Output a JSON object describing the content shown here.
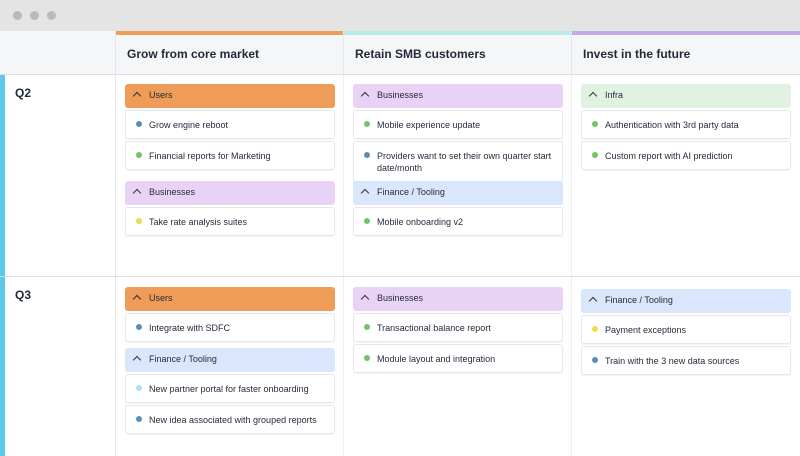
{
  "colors": {
    "blue_dot": "#5b8db5",
    "green_dot": "#72c366",
    "yellow_dot": "#f3d94c",
    "lightblue_dot": "#aee0f5",
    "users_head": "#ee9c57",
    "businesses_head": "#e8d3f6",
    "finance_head": "#dae6fb",
    "infra_head": "#e2f2e2",
    "col1_stripe": "#ee9c57",
    "col2_stripe": "#b9ebe9",
    "col3_stripe": "#c6a9ec",
    "row_stripe": "#5cc8ea"
  },
  "columns": [
    {
      "title": "Grow from core market"
    },
    {
      "title": "Retain SMB customers"
    },
    {
      "title": "Invest in the future"
    }
  ],
  "rows": [
    {
      "title": "Q2"
    },
    {
      "title": "Q3"
    }
  ],
  "cells": {
    "q2_c1": [
      {
        "label": "Users",
        "items": [
          {
            "text": "Grow engine reboot",
            "dot": "blue"
          },
          {
            "text": "Financial reports for Marketing",
            "dot": "green"
          }
        ]
      },
      {
        "label": "Businesses",
        "items": [
          {
            "text": "Take rate analysis suites",
            "dot": "yellow"
          }
        ]
      }
    ],
    "q2_c2": [
      {
        "label": "Businesses",
        "items": [
          {
            "text": "Mobile experience update",
            "dot": "green"
          },
          {
            "text": "Providers want to set their own quarter start date/month",
            "dot": "blue"
          }
        ]
      },
      {
        "label": "Finance / Tooling",
        "items": [
          {
            "text": "Mobile onboarding v2",
            "dot": "green"
          }
        ]
      }
    ],
    "q2_c3": [
      {
        "label": "Infra",
        "items": [
          {
            "text": "Authentication with 3rd party data",
            "dot": "green"
          },
          {
            "text": "Custom report with AI prediction",
            "dot": "green"
          }
        ]
      }
    ],
    "q3_c1": [
      {
        "label": "Users",
        "items": [
          {
            "text": "Integrate with SDFC",
            "dot": "blue"
          }
        ]
      },
      {
        "label": "Finance / Tooling",
        "items": [
          {
            "text": "New partner portal for faster onboarding",
            "dot": "lightblue"
          },
          {
            "text": "New idea associated with grouped reports",
            "dot": "blue"
          }
        ]
      }
    ],
    "q3_c2": [
      {
        "label": "Businesses",
        "items": [
          {
            "text": "Transactional balance report",
            "dot": "green"
          },
          {
            "text": "Module layout and integration",
            "dot": "green"
          }
        ]
      }
    ],
    "q3_c3": [
      {
        "label": "Finance / Tooling",
        "items": [
          {
            "text": "Payment exceptions",
            "dot": "yellow"
          },
          {
            "text": "Train with the 3 new data sources",
            "dot": "blue"
          }
        ]
      }
    ]
  }
}
